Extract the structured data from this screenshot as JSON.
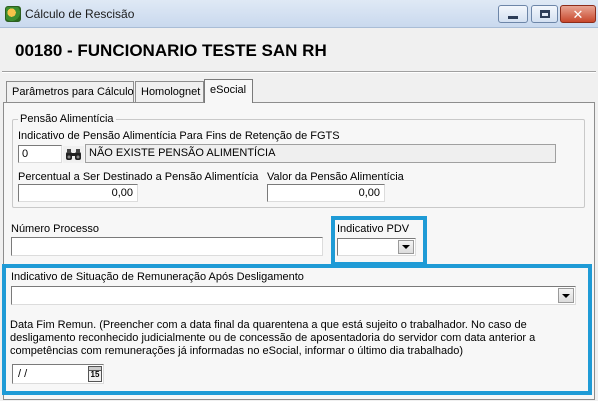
{
  "window": {
    "title": "Cálculo de Rescisão"
  },
  "header": {
    "title": "00180 - FUNCIONARIO TESTE SAN RH"
  },
  "tabs": [
    {
      "label": "Parâmetros para Cálculo",
      "active": false
    },
    {
      "label": "Homolognet",
      "active": false
    },
    {
      "label": "eSocial",
      "active": true
    }
  ],
  "pensao": {
    "group_label": "Pensão Alimentícia",
    "indicativo_label": "Indicativo de Pensão Alimentícia Para Fins de Retenção de FGTS",
    "indicativo_code": "0",
    "indicativo_desc": "NÃO EXISTE PENSÃO ALIMENTÍCIA",
    "percentual_label": "Percentual a Ser Destinado a Pensão Alimentícia",
    "percentual_value": "0,00",
    "valor_label": "Valor da Pensão Alimentícia",
    "valor_value": "0,00"
  },
  "processo": {
    "label": "Número Processo",
    "value": ""
  },
  "pdv": {
    "label": "Indicativo PDV",
    "value": ""
  },
  "remuneracao": {
    "label": "Indicativo de Situação de Remuneração Após Desligamento",
    "value": ""
  },
  "data_fim": {
    "help": "Data Fim Remun. (Preencher com a data final da quarentena a que está sujeito o trabalhador. No caso de desligamento reconhecido judicialmente ou de concessão de aposentadoria do servidor com data anterior a competências com remunerações já informadas no eSocial, informar o último dia trabalhado)",
    "value": " / /",
    "calendar_glyph": "15"
  },
  "colors": {
    "highlight": "#1f9bd6"
  },
  "icons": [
    "app-icon",
    "binoculars-icon",
    "calendar-icon",
    "chevron-down-icon",
    "minimize-icon",
    "maximize-icon",
    "close-icon"
  ]
}
